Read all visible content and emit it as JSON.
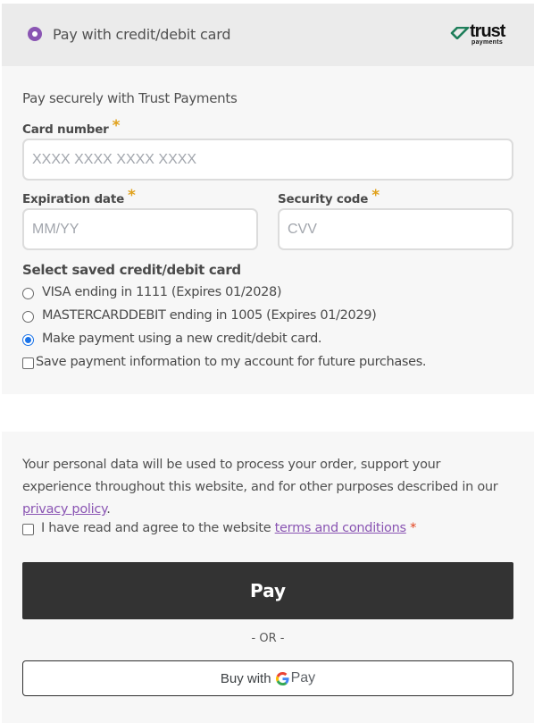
{
  "payment_method": {
    "label": "Pay with credit/debit card",
    "logo": {
      "word": "trust",
      "sub": "payments",
      "icon": "trust-payments-logo-icon",
      "accent_color": "#1e7e5a"
    },
    "radio_color": "#8a55b3"
  },
  "card_form": {
    "intro": "Pay securely with Trust Payments",
    "card_number": {
      "label": "Card number",
      "required_mark": "*",
      "placeholder": "XXXX XXXX XXXX XXXX",
      "value": ""
    },
    "expiration": {
      "label": "Expiration date",
      "required_mark": "*",
      "placeholder": "MM/YY",
      "value": ""
    },
    "security": {
      "label": "Security code",
      "required_mark": "*",
      "placeholder": "CVV",
      "value": ""
    },
    "saved_title": "Select saved credit/debit card",
    "saved_options": [
      {
        "label": "VISA ending in 1111 (Expires 01/2028)",
        "checked": false
      },
      {
        "label": "MASTERCARDDEBIT ending in 1005 (Expires 01/2029)",
        "checked": false
      },
      {
        "label": "Make payment using a new credit/debit card.",
        "checked": true
      }
    ],
    "save_info": {
      "label": "Save payment information to my account for future purchases.",
      "checked": false
    }
  },
  "terms": {
    "privacy_text_before": "Your personal data will be used to process your order, support your experience throughout this website, and for other purposes described in our ",
    "privacy_link": "privacy policy",
    "privacy_text_after": ".",
    "agree_text": "I have read and agree to the website ",
    "terms_link": "terms and conditions",
    "terms_required": "*",
    "agree_checked": false
  },
  "actions": {
    "pay_label": "Pay",
    "or_label": "- OR -",
    "gpay_prefix": "Buy with",
    "gpay_word": "Pay"
  },
  "colors": {
    "accent": "#8a55b3",
    "required": "#e0a11b",
    "button_dark": "#333333",
    "radio_checked": "#1a73e8"
  }
}
